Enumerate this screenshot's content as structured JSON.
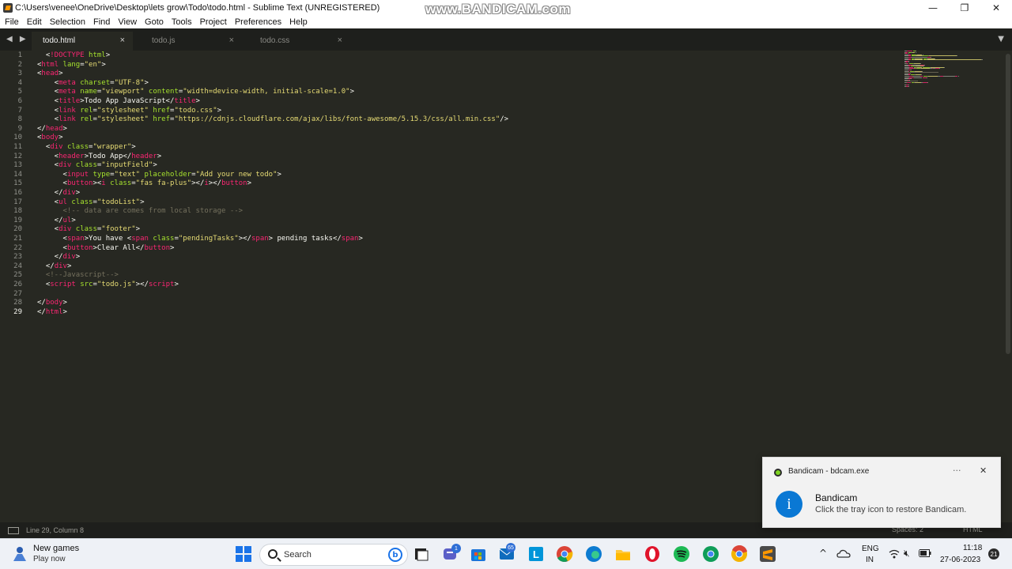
{
  "window": {
    "title": "C:\\Users\\venee\\OneDrive\\Desktop\\lets grow\\Todo\\todo.html - Sublime Text (UNREGISTERED)",
    "watermark": "www.BANDICAM.com",
    "controls": {
      "minimize": "—",
      "maximize": "❐",
      "close": "✕"
    }
  },
  "menu": {
    "items": [
      "File",
      "Edit",
      "Selection",
      "Find",
      "View",
      "Goto",
      "Tools",
      "Project",
      "Preferences",
      "Help"
    ]
  },
  "tabs": [
    {
      "label": "todo.html",
      "close": "×"
    },
    {
      "label": "todo.js",
      "close": "×"
    },
    {
      "label": "todo.css",
      "close": "×"
    }
  ],
  "tab_nav": "◀ ▶",
  "tab_dropdown": "▼",
  "editor": {
    "current_line": 29,
    "lines": [
      [
        [
          "p",
          "  <"
        ],
        [
          "doct",
          "!DOCTYPE"
        ],
        [
          "p",
          " "
        ],
        [
          "attr",
          "html"
        ],
        [
          "p",
          ">"
        ]
      ],
      [
        [
          "p",
          "<"
        ],
        [
          "tag",
          "html"
        ],
        [
          "p",
          " "
        ],
        [
          "attr",
          "lang"
        ],
        [
          "p",
          "="
        ],
        [
          "str",
          "\"en\""
        ],
        [
          "p",
          ">"
        ]
      ],
      [
        [
          "p",
          "<"
        ],
        [
          "tag",
          "head"
        ],
        [
          "p",
          ">"
        ]
      ],
      [
        [
          "p",
          "    <"
        ],
        [
          "tag",
          "meta"
        ],
        [
          "p",
          " "
        ],
        [
          "attr",
          "charset"
        ],
        [
          "p",
          "="
        ],
        [
          "str",
          "\"UTF-8\""
        ],
        [
          "p",
          ">"
        ]
      ],
      [
        [
          "p",
          "    <"
        ],
        [
          "tag",
          "meta"
        ],
        [
          "p",
          " "
        ],
        [
          "attr",
          "name"
        ],
        [
          "p",
          "="
        ],
        [
          "str",
          "\"viewport\""
        ],
        [
          "p",
          " "
        ],
        [
          "attr",
          "content"
        ],
        [
          "p",
          "="
        ],
        [
          "str",
          "\"width=device-width, initial-scale=1.0\""
        ],
        [
          "p",
          ">"
        ]
      ],
      [
        [
          "p",
          "    <"
        ],
        [
          "tag",
          "title"
        ],
        [
          "p",
          ">Todo App JavaScript</"
        ],
        [
          "tag",
          "title"
        ],
        [
          "p",
          ">"
        ]
      ],
      [
        [
          "p",
          "    <"
        ],
        [
          "tag",
          "link"
        ],
        [
          "p",
          " "
        ],
        [
          "attr",
          "rel"
        ],
        [
          "p",
          "="
        ],
        [
          "str",
          "\"stylesheet\""
        ],
        [
          "p",
          " "
        ],
        [
          "attr",
          "href"
        ],
        [
          "p",
          "="
        ],
        [
          "str",
          "\"todo.css\""
        ],
        [
          "p",
          ">"
        ]
      ],
      [
        [
          "p",
          "    <"
        ],
        [
          "tag",
          "link"
        ],
        [
          "p",
          " "
        ],
        [
          "attr",
          "rel"
        ],
        [
          "p",
          "="
        ],
        [
          "str",
          "\"stylesheet\""
        ],
        [
          "p",
          " "
        ],
        [
          "attr",
          "href"
        ],
        [
          "p",
          "="
        ],
        [
          "str",
          "\"https://cdnjs.cloudflare.com/ajax/libs/font-awesome/5.15.3/css/all.min.css\""
        ],
        [
          "p",
          "/>"
        ]
      ],
      [
        [
          "p",
          "</"
        ],
        [
          "tag",
          "head"
        ],
        [
          "p",
          ">"
        ]
      ],
      [
        [
          "p",
          "<"
        ],
        [
          "tag",
          "body"
        ],
        [
          "p",
          ">"
        ]
      ],
      [
        [
          "p",
          "  <"
        ],
        [
          "tag",
          "div"
        ],
        [
          "p",
          " "
        ],
        [
          "attr",
          "class"
        ],
        [
          "p",
          "="
        ],
        [
          "str",
          "\"wrapper\""
        ],
        [
          "p",
          ">"
        ]
      ],
      [
        [
          "p",
          "    <"
        ],
        [
          "tag",
          "header"
        ],
        [
          "p",
          ">Todo App</"
        ],
        [
          "tag",
          "header"
        ],
        [
          "p",
          ">"
        ]
      ],
      [
        [
          "p",
          "    <"
        ],
        [
          "tag",
          "div"
        ],
        [
          "p",
          " "
        ],
        [
          "attr",
          "class"
        ],
        [
          "p",
          "="
        ],
        [
          "str",
          "\"inputField\""
        ],
        [
          "p",
          ">"
        ]
      ],
      [
        [
          "p",
          "      <"
        ],
        [
          "tag",
          "input"
        ],
        [
          "p",
          " "
        ],
        [
          "attr",
          "type"
        ],
        [
          "p",
          "="
        ],
        [
          "str",
          "\"text\""
        ],
        [
          "p",
          " "
        ],
        [
          "attr",
          "placeholder"
        ],
        [
          "p",
          "="
        ],
        [
          "str",
          "\"Add your new todo\""
        ],
        [
          "p",
          ">"
        ]
      ],
      [
        [
          "p",
          "      <"
        ],
        [
          "tag",
          "button"
        ],
        [
          "p",
          ">"
        ],
        [
          "p",
          "<"
        ],
        [
          "tag",
          "i"
        ],
        [
          "p",
          " "
        ],
        [
          "attr",
          "class"
        ],
        [
          "p",
          "="
        ],
        [
          "str",
          "\"fas fa-plus\""
        ],
        [
          "p",
          ">"
        ],
        [
          "p",
          "</"
        ],
        [
          "tag",
          "i"
        ],
        [
          "p",
          ">"
        ],
        [
          "p",
          "</"
        ],
        [
          "tag",
          "button"
        ],
        [
          "p",
          ">"
        ]
      ],
      [
        [
          "p",
          "    </"
        ],
        [
          "tag",
          "div"
        ],
        [
          "p",
          ">"
        ]
      ],
      [
        [
          "p",
          "    <"
        ],
        [
          "tag",
          "ul"
        ],
        [
          "p",
          " "
        ],
        [
          "attr",
          "class"
        ],
        [
          "p",
          "="
        ],
        [
          "str",
          "\"todoList\""
        ],
        [
          "p",
          ">"
        ]
      ],
      [
        [
          "cmt",
          "      <!-- data are comes from local storage -->"
        ]
      ],
      [
        [
          "p",
          "    </"
        ],
        [
          "tag",
          "ul"
        ],
        [
          "p",
          ">"
        ]
      ],
      [
        [
          "p",
          "    <"
        ],
        [
          "tag",
          "div"
        ],
        [
          "p",
          " "
        ],
        [
          "attr",
          "class"
        ],
        [
          "p",
          "="
        ],
        [
          "str",
          "\"footer\""
        ],
        [
          "p",
          ">"
        ]
      ],
      [
        [
          "p",
          "      <"
        ],
        [
          "tag",
          "span"
        ],
        [
          "p",
          ">You have <"
        ],
        [
          "tag",
          "span"
        ],
        [
          "p",
          " "
        ],
        [
          "attr",
          "class"
        ],
        [
          "p",
          "="
        ],
        [
          "str",
          "\"pendingTasks\""
        ],
        [
          "p",
          "></"
        ],
        [
          "tag",
          "span"
        ],
        [
          "p",
          "> pending tasks</"
        ],
        [
          "tag",
          "span"
        ],
        [
          "p",
          ">"
        ]
      ],
      [
        [
          "p",
          "      <"
        ],
        [
          "tag",
          "button"
        ],
        [
          "p",
          ">Clear All</"
        ],
        [
          "tag",
          "button"
        ],
        [
          "p",
          ">"
        ]
      ],
      [
        [
          "p",
          "    </"
        ],
        [
          "tag",
          "div"
        ],
        [
          "p",
          ">"
        ]
      ],
      [
        [
          "p",
          "  </"
        ],
        [
          "tag",
          "div"
        ],
        [
          "p",
          ">"
        ]
      ],
      [
        [
          "cmt",
          "  <!--Javascript-->"
        ]
      ],
      [
        [
          "p",
          "  <"
        ],
        [
          "tag",
          "script"
        ],
        [
          "p",
          " "
        ],
        [
          "attr",
          "src"
        ],
        [
          "p",
          "="
        ],
        [
          "str",
          "\"todo.js\""
        ],
        [
          "p",
          "></"
        ],
        [
          "tag",
          "script"
        ],
        [
          "p",
          ">"
        ]
      ],
      [
        [
          "p",
          ""
        ]
      ],
      [
        [
          "p",
          "</"
        ],
        [
          "tag",
          "body"
        ],
        [
          "p",
          ">"
        ]
      ],
      [
        [
          "p",
          "</"
        ],
        [
          "tag",
          "html"
        ],
        [
          "p",
          ">"
        ]
      ]
    ]
  },
  "status": {
    "position": "Line 29, Column 8",
    "spaces": "Spaces: 2",
    "syntax": "HTML"
  },
  "toast": {
    "app": "Bandicam - bdcam.exe",
    "more": "···",
    "close": "✕",
    "icon": "i",
    "title": "Bandicam",
    "body": "Click the tray icon to restore Bandicam."
  },
  "taskbar": {
    "weather_title": "New games",
    "weather_sub": "Play now",
    "search_label": "Search",
    "teams_badge": "1",
    "mail_badge": "65",
    "lang_line1": "ENG",
    "lang_line2": "IN",
    "time": "11:18",
    "date": "27-06-2023",
    "notifications": "21"
  },
  "colors": {
    "editor_bg": "#272822",
    "tag": "#f92672",
    "attribute": "#a6e22e",
    "string": "#e6db74",
    "comment": "#75715e",
    "text": "#f8f8f2"
  }
}
